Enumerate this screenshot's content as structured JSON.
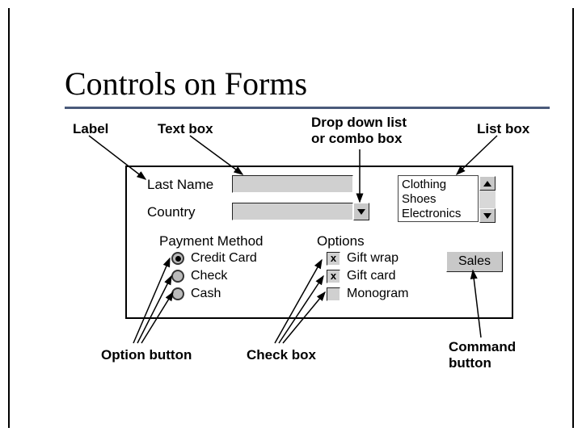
{
  "title": "Controls on Forms",
  "annotations": {
    "label": "Label",
    "textbox": "Text box",
    "dropdown": "Drop down list\nor combo box",
    "listbox": "List box",
    "option_button": "Option button",
    "check_box": "Check box",
    "command_button": "Command\nbutton"
  },
  "form": {
    "last_name_label": "Last Name",
    "country_label": "Country",
    "last_name_value": "",
    "country_value": "",
    "listbox_items": [
      "Clothing",
      "Shoes",
      "Electronics"
    ],
    "payment_method_label": "Payment Method",
    "payment_options": [
      {
        "label": "Credit Card",
        "selected": true
      },
      {
        "label": "Check",
        "selected": false
      },
      {
        "label": "Cash",
        "selected": false
      }
    ],
    "options_label": "Options",
    "checkbox_options": [
      {
        "label": "Gift wrap",
        "checked": true
      },
      {
        "label": "Gift card",
        "checked": true
      },
      {
        "label": "Monogram",
        "checked": false
      }
    ],
    "command_button_label": "Sales"
  }
}
